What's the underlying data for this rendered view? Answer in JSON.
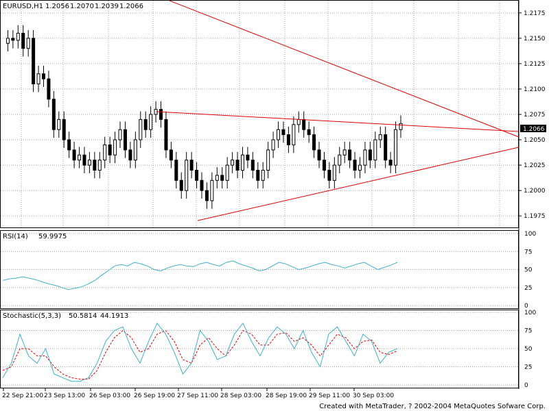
{
  "header": {
    "symbol": "EURUSD,H1",
    "open": "1.2056",
    "high": "1.2070",
    "low": "1.2039",
    "close": "1.2066"
  },
  "price_axis": {
    "ticks": [
      "1.2175",
      "1.2150",
      "1.2125",
      "1.2100",
      "1.2075",
      "1.2050",
      "1.2025",
      "1.2000",
      "1.1975"
    ],
    "current_price": "1.2066"
  },
  "rsi": {
    "label": "RSI(14)",
    "value": "59.9975",
    "ticks": [
      "100",
      "75",
      "50",
      "25",
      "0"
    ]
  },
  "stochastic": {
    "label": "Stochastic(5,3,3)",
    "main_value": "50.5814",
    "signal_value": "44.1913",
    "ticks": [
      "100",
      "75",
      "50",
      "25",
      "0"
    ]
  },
  "time_axis": {
    "labels": [
      "22 Sep 21:00",
      "23 Sep 13:00",
      "26 Sep 03:00",
      "26 Sep 19:00",
      "27 Sep 11:00",
      "28 Sep 03:00",
      "28 Sep 19:00",
      "29 Sep 11:00",
      "30 Sep 03:00"
    ]
  },
  "footer": "Created with MetaTrader, ? 2002-2004 MetaQuotes Sofware Corp.",
  "colors": {
    "candles": "#000000",
    "trendlines": "#e00000",
    "rsi_line": "#3fb0c8",
    "stoch_main": "#3fb0c8",
    "stoch_signal": "#e00000",
    "grid": "#a0a0a0"
  },
  "chart_data": {
    "type": "line",
    "price_ylim": [
      1.1965,
      1.2185
    ],
    "close_series": [
      1.2145,
      1.215,
      1.2148,
      1.2155,
      1.214,
      1.215,
      1.2105,
      1.2115,
      1.211,
      1.209,
      1.206,
      1.207,
      1.205,
      1.204,
      1.203,
      1.2035,
      1.2025,
      1.203,
      1.202,
      1.203,
      1.2045,
      1.2035,
      1.205,
      1.206,
      1.204,
      1.203,
      1.205,
      1.207,
      1.206,
      1.2075,
      1.208,
      1.207,
      1.204,
      1.203,
      1.201,
      1.2,
      1.203,
      1.202,
      1.201,
      1.2,
      1.199,
      1.201,
      1.2015,
      1.201,
      1.2025,
      1.203,
      1.202,
      1.2035,
      1.203,
      1.202,
      1.201,
      1.202,
      1.204,
      1.205,
      1.206,
      1.2055,
      1.2045,
      1.2065,
      1.207,
      1.206,
      1.2055,
      1.204,
      1.203,
      1.202,
      1.201,
      1.2025,
      1.2035,
      1.204,
      1.203,
      1.202,
      1.2025,
      1.204,
      1.203,
      1.205,
      1.2055,
      1.203,
      1.2025,
      1.206,
      1.2066
    ],
    "rsi_series": [
      35,
      37,
      38,
      40,
      38,
      36,
      33,
      30,
      28,
      25,
      22,
      24,
      26,
      30,
      35,
      42,
      48,
      55,
      57,
      55,
      60,
      58,
      55,
      50,
      48,
      52,
      55,
      57,
      55,
      54,
      58,
      60,
      57,
      55,
      60,
      62,
      58,
      55,
      52,
      48,
      50,
      55,
      60,
      58,
      54,
      50,
      52,
      55,
      58,
      60,
      57,
      55,
      52,
      55,
      58,
      60,
      55,
      50,
      53,
      56,
      60
    ],
    "stoch_main_series": [
      10,
      30,
      70,
      40,
      30,
      50,
      15,
      10,
      5,
      5,
      10,
      30,
      60,
      75,
      80,
      50,
      30,
      60,
      85,
      70,
      45,
      15,
      30,
      75,
      60,
      35,
      40,
      70,
      85,
      60,
      40,
      65,
      80,
      70,
      50,
      75,
      45,
      25,
      70,
      80,
      60,
      40,
      70,
      60,
      30,
      45,
      50
    ],
    "stoch_signal_series": [
      20,
      25,
      50,
      50,
      40,
      40,
      25,
      15,
      10,
      8,
      8,
      20,
      45,
      65,
      75,
      65,
      45,
      50,
      70,
      75,
      60,
      35,
      30,
      55,
      65,
      50,
      40,
      55,
      75,
      70,
      55,
      55,
      70,
      72,
      60,
      65,
      55,
      40,
      55,
      70,
      65,
      50,
      60,
      62,
      45,
      42,
      47
    ]
  }
}
